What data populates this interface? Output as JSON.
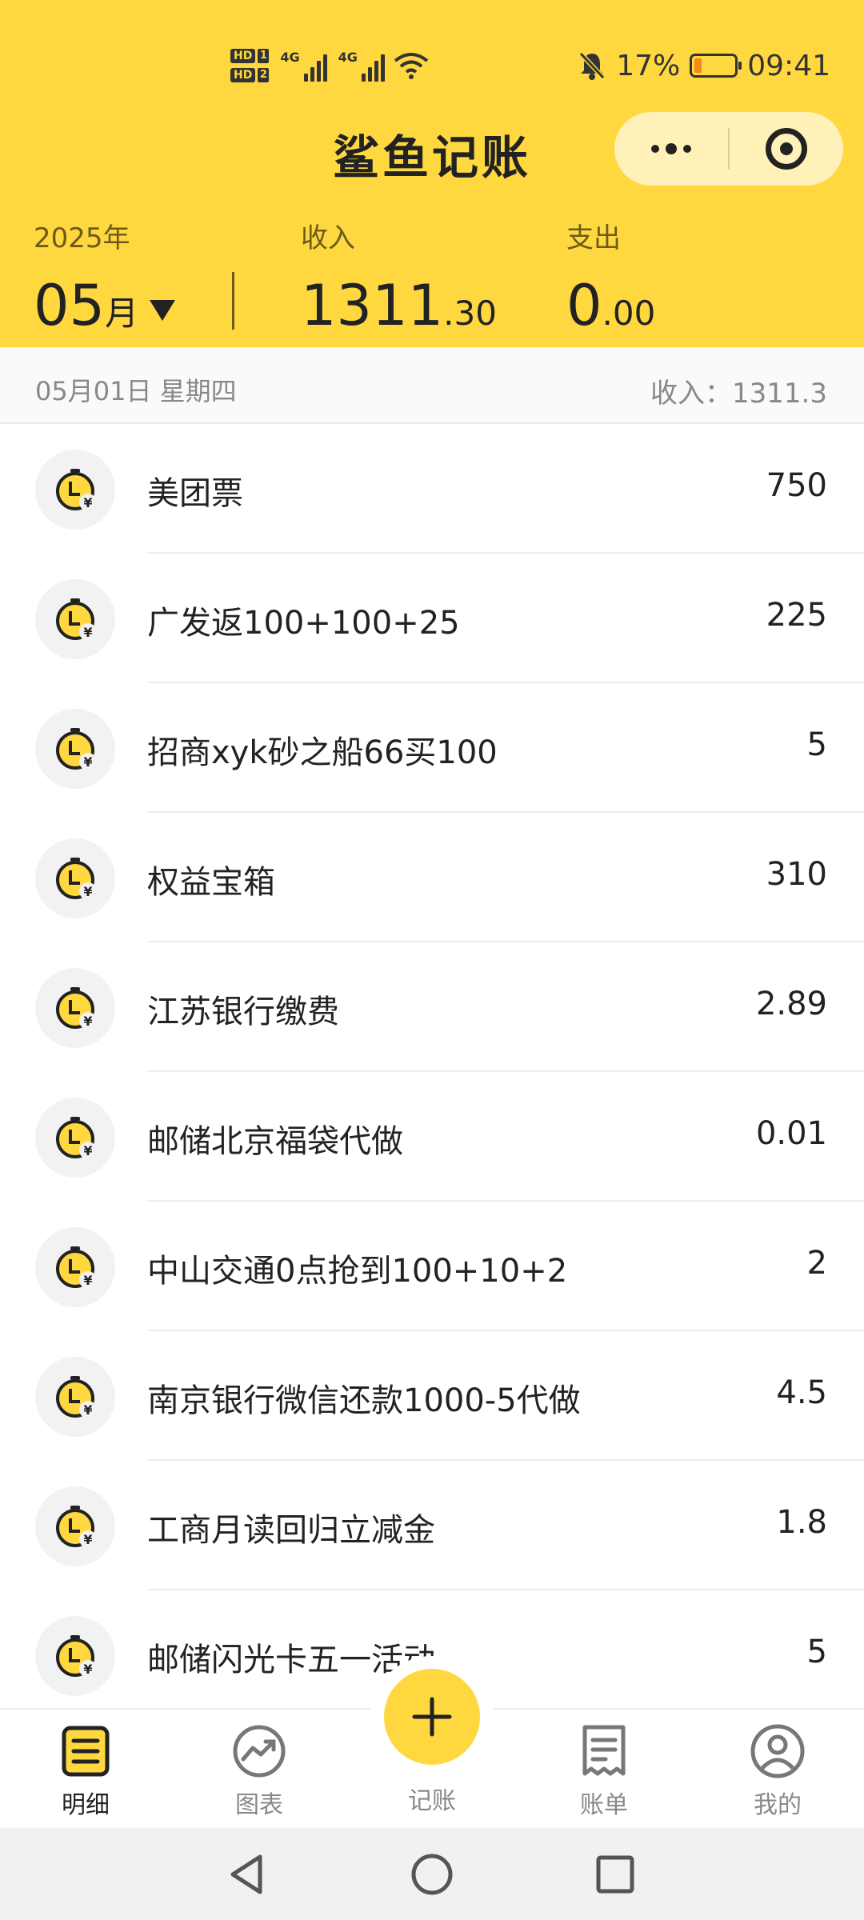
{
  "status_bar": {
    "hd1": "HD",
    "hd1_num": "1",
    "hd2": "HD",
    "hd2_num": "2",
    "net1": "4G",
    "net2": "4G",
    "battery": "17%",
    "time": "09:41"
  },
  "header": {
    "title": "鲨鱼记账",
    "year": "2025年",
    "month_num": "05",
    "month_unit": "月",
    "income_label": "收入",
    "income_int": "1311",
    "income_dec": ".30",
    "expense_label": "支出",
    "expense_int": "0",
    "expense_dec": ".00",
    "accent_color": "#FFD83F"
  },
  "day": {
    "date": "05月01日 星期四",
    "total": "收入：1311.3"
  },
  "records": [
    {
      "name": "美团票",
      "amount": "750",
      "icon": "income-clock-yen-icon"
    },
    {
      "name": "广发返100+100+25",
      "amount": "225",
      "icon": "income-clock-yen-icon"
    },
    {
      "name": "招商xyk砂之船66买100",
      "amount": "5",
      "icon": "income-clock-yen-icon"
    },
    {
      "name": "权益宝箱",
      "amount": "310",
      "icon": "income-clock-yen-icon"
    },
    {
      "name": "江苏银行缴费",
      "amount": "2.89",
      "icon": "income-clock-yen-icon"
    },
    {
      "name": "邮储北京福袋代做",
      "amount": "0.01",
      "icon": "income-clock-yen-icon"
    },
    {
      "name": "中山交通0点抢到100+10+2",
      "amount": "2",
      "icon": "income-clock-yen-icon"
    },
    {
      "name": "南京银行微信还款1000-5代做",
      "amount": "4.5",
      "icon": "income-clock-yen-icon"
    },
    {
      "name": "工商月读回归立减金",
      "amount": "1.8",
      "icon": "income-clock-yen-icon"
    },
    {
      "name": "邮储闪光卡五一活动",
      "amount": "5",
      "icon": "income-clock-yen-icon"
    }
  ],
  "tabs": [
    {
      "label": "明细",
      "icon": "list-icon",
      "active": true
    },
    {
      "label": "图表",
      "icon": "chart-icon",
      "active": false
    },
    {
      "label": "记账",
      "icon": "plus-icon",
      "active": false
    },
    {
      "label": "账单",
      "icon": "receipt-icon",
      "active": false
    },
    {
      "label": "我的",
      "icon": "profile-icon",
      "active": false
    }
  ]
}
